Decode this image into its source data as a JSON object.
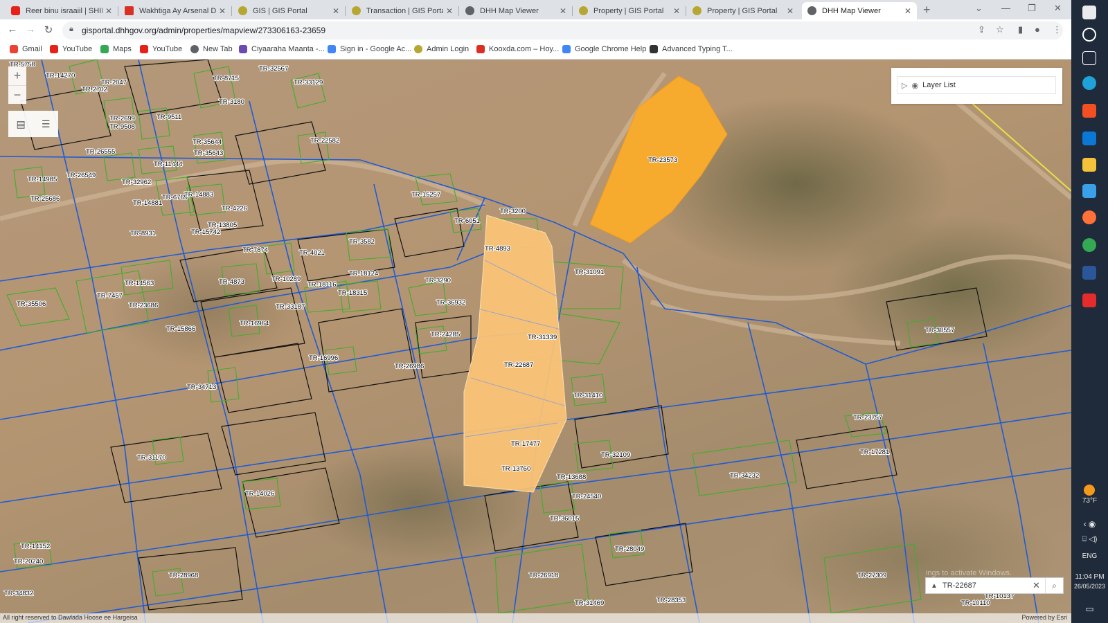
{
  "tabs": [
    {
      "title": "Reer binu israaiil | SHIIKH...",
      "color": "#e62117"
    },
    {
      "title": "Wakhtiga Ay Arsenal Dalb...",
      "color": "#d93025"
    },
    {
      "title": "GIS | GIS Portal",
      "color": "#b7a732"
    },
    {
      "title": "Transaction | GIS Portal",
      "color": "#b7a732"
    },
    {
      "title": "DHH Map Viewer",
      "color": "#5f6368"
    },
    {
      "title": "Property | GIS Portal",
      "color": "#b7a732"
    },
    {
      "title": "Property | GIS Portal",
      "color": "#b7a732"
    },
    {
      "title": "DHH Map Viewer",
      "color": "#5f6368"
    }
  ],
  "url": "gisportal.dhhgov.org/admin/properties/mapview/273306163-23659",
  "bookmarks": [
    {
      "label": "Gmail",
      "color": "#ea4335"
    },
    {
      "label": "YouTube",
      "color": "#e62117"
    },
    {
      "label": "Maps",
      "color": "#34a853"
    },
    {
      "label": "YouTube",
      "color": "#e62117"
    },
    {
      "label": "New Tab",
      "color": "#5f6368"
    },
    {
      "label": "Ciyaaraha Maanta -...",
      "color": "#6b4bb3"
    },
    {
      "label": "Sign in - Google Ac...",
      "color": "#4285f4"
    },
    {
      "label": "Admin Login",
      "color": "#b7a732"
    },
    {
      "label": "Kooxda.com – Hoy...",
      "color": "#d93025"
    },
    {
      "label": "Google Chrome Help",
      "color": "#4285f4"
    },
    {
      "label": "Advanced Typing T...",
      "color": "#333333"
    }
  ],
  "map": {
    "layer_list_title": "Layer List",
    "search_value": "TR-22687",
    "watermark": "ings to activate Windows.",
    "attribution_left": "All right reserved to Dawlada Hoose ee Hargeisa",
    "attribution_right": "Powered by Esri",
    "highlight_parcel": "TR-22687",
    "selected_parcel": "TR-23573",
    "colors": {
      "selected": "#f7ab2e",
      "highlight": "#fcc476",
      "roads": "#1f5bd6",
      "parcels_green": "#3fae2a",
      "parcels_black": "#111111"
    },
    "parcel_labels": [
      "TR-5758",
      "TR-14270",
      "TR-2047",
      "TR-2702",
      "TR-8715",
      "TR-32567",
      "TR-33129",
      "TR-3180",
      "TR-2699",
      "TR-9508",
      "TR-9511",
      "TR-35644",
      "TR-35643",
      "TR-22582",
      "TR-26555",
      "TR-11444",
      "TR-14985",
      "TR-26549",
      "TR-32962",
      "TR-25686",
      "TR-14881",
      "TR-6769",
      "TR-14883",
      "TR-4226",
      "TR-13805",
      "TR-15742",
      "TR-8931",
      "TR-15257",
      "TR-6051",
      "TR-3200",
      "TR-4893",
      "TR-3582",
      "TR-7874",
      "TR-4021",
      "TR-4873",
      "TR-10289",
      "TR-18116",
      "TR-18124",
      "TR-3290",
      "TR-31091",
      "TR-14563",
      "TR-7457",
      "TR-23686",
      "TR-35506",
      "TR-18315",
      "TR-33187",
      "TR-36932",
      "TR-16964",
      "TR-15866",
      "TR-24285",
      "TR-31339",
      "TR-16996",
      "TR-26986",
      "TR-22687",
      "TR-34713",
      "TR-31410",
      "TR-30557",
      "TR-23757",
      "TR-17281",
      "TR-17477",
      "TR-32109",
      "TR-31170",
      "TR-13760",
      "TR-13688",
      "TR-34232",
      "TR-14026",
      "TR-24540",
      "TR-36015",
      "TR-14152",
      "TR-20240",
      "TR-28049",
      "TR-28968",
      "TR-26918",
      "TR-27309",
      "TR-34832",
      "TR-28353",
      "TR-31469",
      "TR-10137",
      "TR-10110",
      "TR-23573"
    ]
  },
  "taskbar": {
    "weather": "73°F",
    "lang": "ENG",
    "time": "11:04 PM",
    "date": "26/05/2023"
  }
}
